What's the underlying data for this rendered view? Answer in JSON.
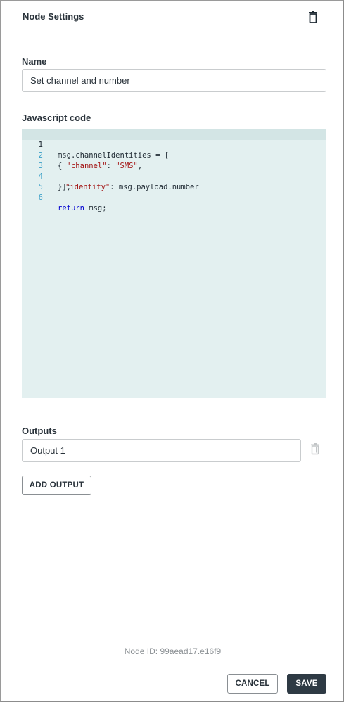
{
  "header": {
    "title": "Node Settings",
    "delete_icon": "trash-icon"
  },
  "name_section": {
    "label": "Name",
    "value": "Set channel and number"
  },
  "code_section": {
    "label": "Javascript code",
    "lines": [
      {
        "number": "1"
      },
      {
        "number": "2"
      },
      {
        "number": "3"
      },
      {
        "number": "4"
      },
      {
        "number": "5"
      },
      {
        "number": "6"
      }
    ],
    "tokens": {
      "l1": "msg.channelIdentities = [",
      "l2_a": "{ ",
      "l2_b": "\"channel\"",
      "l2_c": ": ",
      "l2_d": "\"SMS\"",
      "l2_e": ",",
      "l3_b": "\"identity\"",
      "l3_c": ": msg.payload.number",
      "l4": "}];",
      "l6_kw": "return",
      "l6_rest": " msg;"
    }
  },
  "outputs_section": {
    "label": "Outputs",
    "items": [
      {
        "value": "Output 1",
        "delete_icon": "trash-icon"
      }
    ],
    "add_label": "ADD OUTPUT"
  },
  "footer": {
    "node_id": "Node ID: 99aead17.e16f9",
    "cancel_label": "CANCEL",
    "save_label": "SAVE"
  },
  "colors": {
    "editor_bg": "#e3f0f0",
    "line_number": "#3a9fc7",
    "string": "#a31515",
    "keyword": "#0000d0",
    "primary_button": "#2e3a44"
  }
}
